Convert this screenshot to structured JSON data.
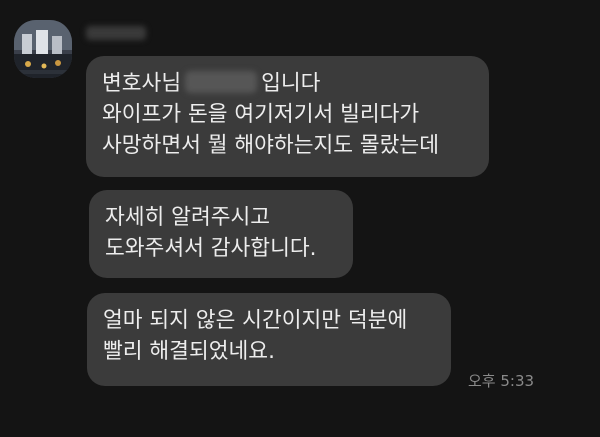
{
  "chat": {
    "sender": {
      "avatar_icon": "profile-photo",
      "name": ""
    },
    "messages": [
      {
        "lines": [
          "변호사님",
          "입니다"
        ],
        "redacted_name": true,
        "extra_lines": [
          "와이프가 돈을 여기저기서 빌리다가",
          "사망하면서 뭘 해야하는지도 몰랐는데"
        ]
      },
      {
        "lines": [
          "자세히 알려주시고",
          "도와주셔서 감사합니다."
        ]
      },
      {
        "lines": [
          "얼마 되지 않은 시간이지만 덕분에",
          "빨리 해결되었네요."
        ]
      }
    ],
    "timestamp": "오후 5:33"
  }
}
